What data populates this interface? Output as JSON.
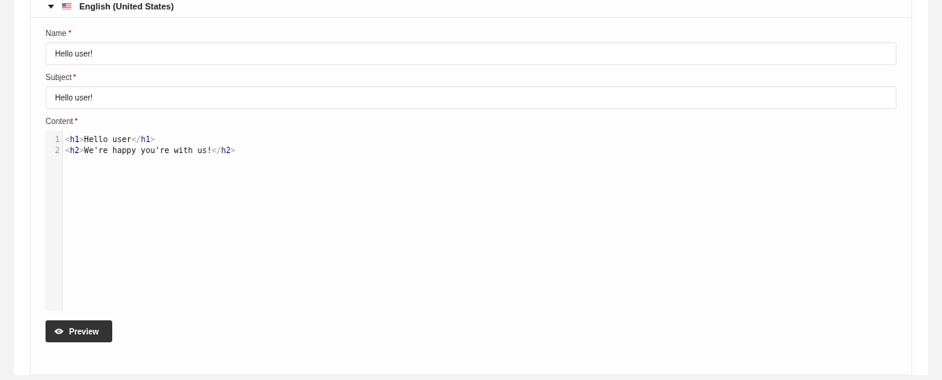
{
  "section": {
    "title": "English (United States)",
    "expanded": true
  },
  "fields": [
    {
      "label": "Name",
      "required": true,
      "value": "Hello user!"
    },
    {
      "label": "Subject",
      "required": true,
      "value": "Hello user!"
    }
  ],
  "content": {
    "label": "Content",
    "required": true,
    "lines": [
      {
        "number": "1",
        "tokens": [
          {
            "kind": "punct",
            "text": "<"
          },
          {
            "kind": "tag",
            "text": "h1"
          },
          {
            "kind": "punct",
            "text": ">"
          },
          {
            "kind": "text",
            "text": "Hello user"
          },
          {
            "kind": "punct",
            "text": "</"
          },
          {
            "kind": "tag",
            "text": "h1"
          },
          {
            "kind": "punct",
            "text": ">"
          }
        ]
      },
      {
        "number": "2",
        "tokens": [
          {
            "kind": "punct",
            "text": "<"
          },
          {
            "kind": "tag",
            "text": "h2"
          },
          {
            "kind": "punct",
            "text": ">"
          },
          {
            "kind": "text",
            "text": "We're happy you're with us!"
          },
          {
            "kind": "punct",
            "text": "</"
          },
          {
            "kind": "tag",
            "text": "h2"
          },
          {
            "kind": "punct",
            "text": ">"
          }
        ]
      }
    ]
  },
  "preview_button": "Preview"
}
